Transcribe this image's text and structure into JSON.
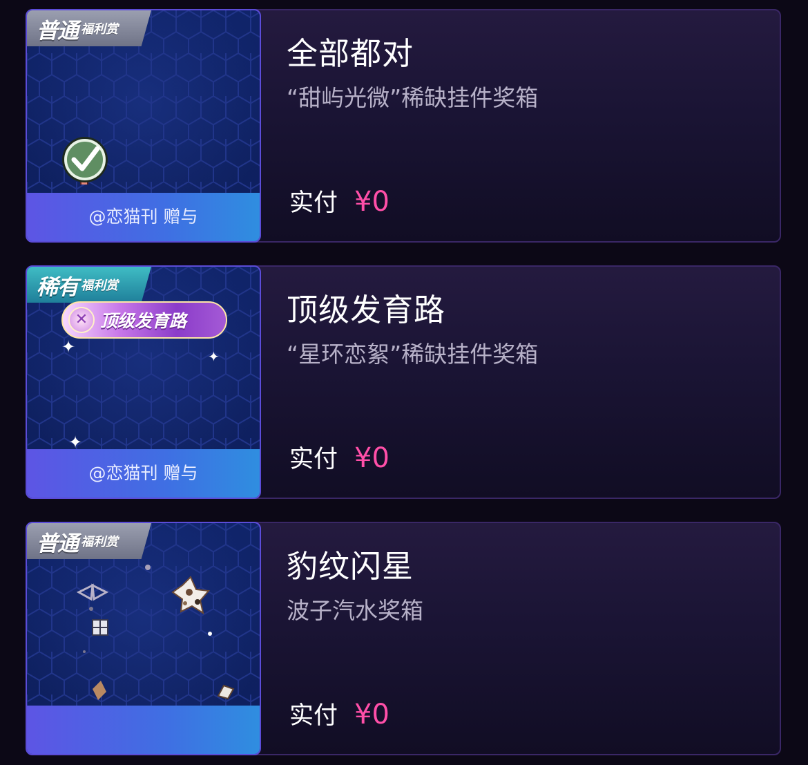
{
  "colors": {
    "background": "#0c0816",
    "price": "#ff4fa8",
    "giver_bar": "#4a64e3"
  },
  "cards": [
    {
      "tag_big": "普通",
      "tag_small": "福利赏",
      "tag_type": "normal",
      "title": "全部都对",
      "subtitle": "“甜屿光微”稀缺挂件奖箱",
      "pay_label": "实付",
      "price": "¥0",
      "giver": "@恋猫刊 赠与",
      "icon": "check-icon"
    },
    {
      "tag_big": "稀有",
      "tag_small": "福利赏",
      "tag_type": "rare",
      "title": "顶级发育路",
      "subtitle": "“星环恋絮”稀缺挂件奖箱",
      "pay_label": "实付",
      "price": "¥0",
      "giver": "@恋猫刊 赠与",
      "badge_text": "顶级发育路",
      "icon": "title-badge-icon"
    },
    {
      "tag_big": "普通",
      "tag_small": "福利赏",
      "tag_type": "normal",
      "title": "豹纹闪星",
      "subtitle": "波子汽水奖箱",
      "pay_label": "实付",
      "price": "¥0",
      "giver": "",
      "icon": "leopard-star-icon"
    }
  ]
}
